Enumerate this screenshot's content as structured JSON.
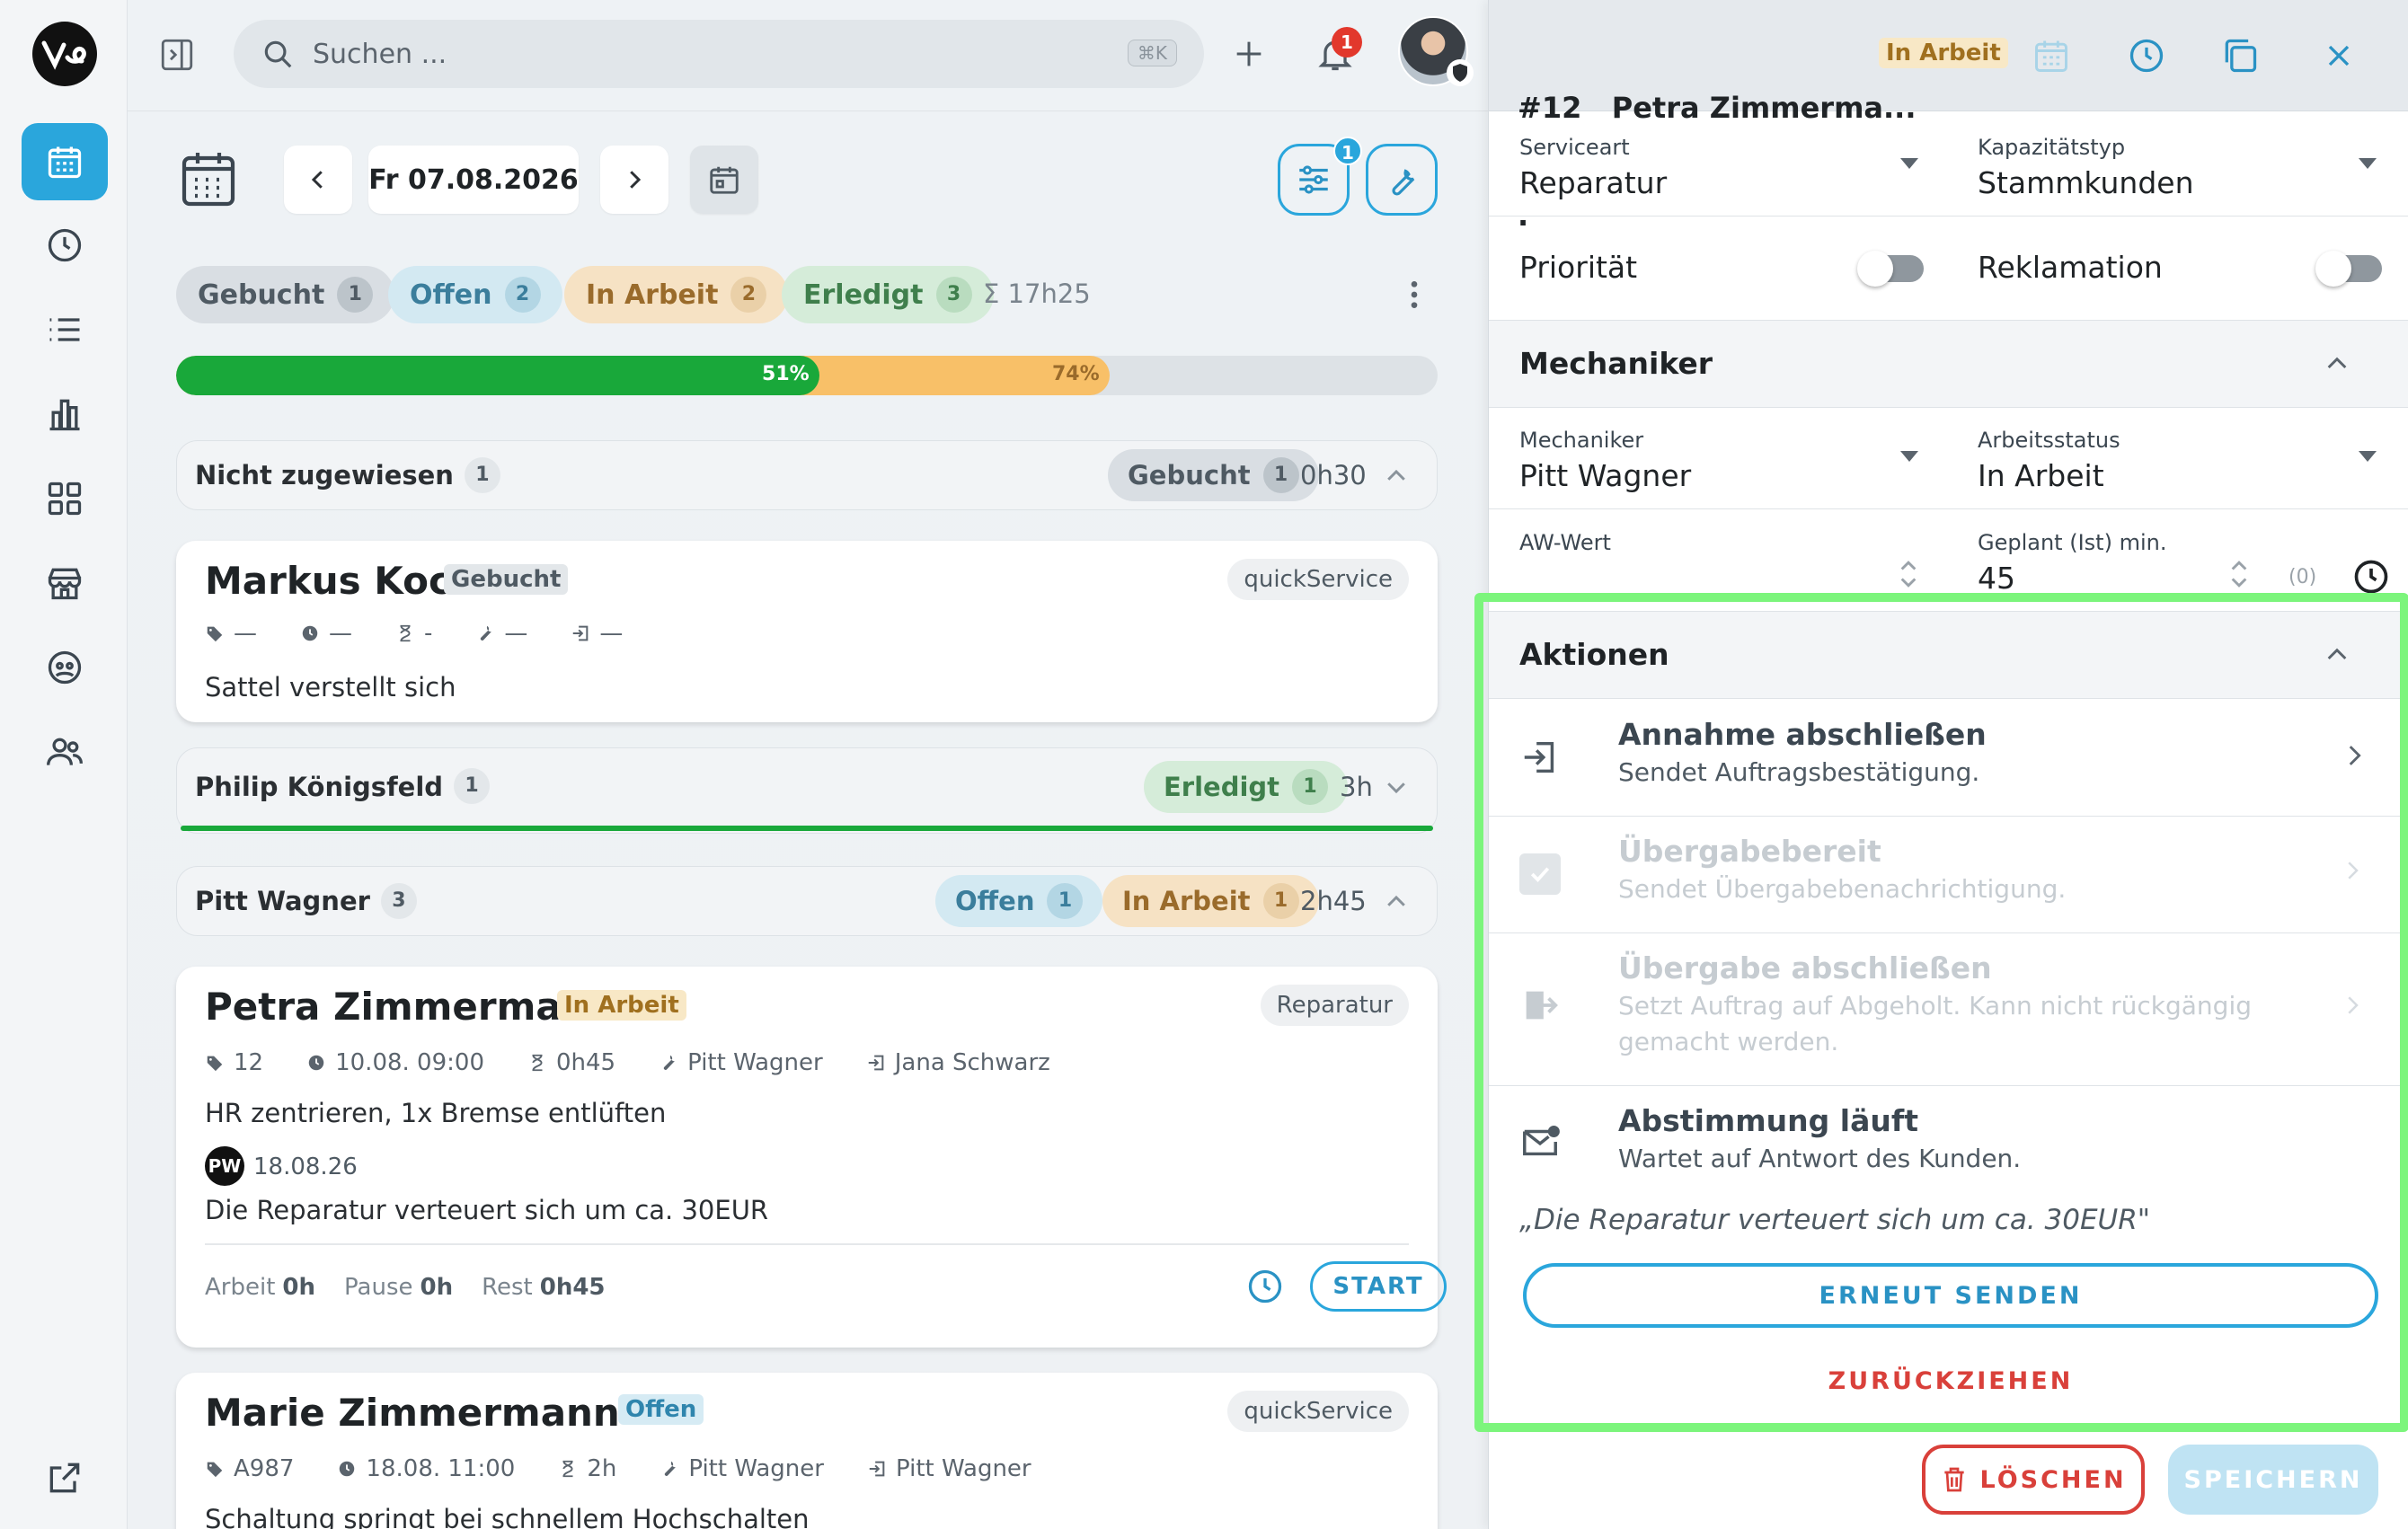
{
  "rail": {
    "logo_icon": "brand-logo",
    "items": [
      "calendar-icon",
      "clock-icon",
      "list-icon",
      "chart-icon",
      "grid-icon",
      "store-icon",
      "support-icon",
      "users-icon"
    ],
    "bottom": "external-link-icon"
  },
  "topbar": {
    "search_placeholder": "Suchen ...",
    "shortcut": "⌘K",
    "notification_count": "1"
  },
  "toolbar": {
    "date": "Fr 07.08.2026",
    "filter_count": "1"
  },
  "status": {
    "booked": {
      "label": "Gebucht",
      "count": "1"
    },
    "open": {
      "label": "Offen",
      "count": "2"
    },
    "in_work": {
      "label": "In Arbeit",
      "count": "2"
    },
    "done": {
      "label": "Erledigt",
      "count": "3"
    },
    "total": "Σ 17h25"
  },
  "progress": {
    "done_pct": 51,
    "work_pct": 74,
    "done_label": "51%",
    "work_label": "74%"
  },
  "groups": {
    "unassigned": {
      "name": "Nicht zugewiesen",
      "count": "1",
      "chip_label": "Gebucht",
      "chip_count": "1",
      "time": "0h30"
    },
    "philip": {
      "name": "Philip Königsfeld",
      "count": "1",
      "chip_label": "Erledigt",
      "chip_count": "1",
      "time": "3h"
    },
    "pitt": {
      "name": "Pitt Wagner",
      "count": "3",
      "chip1_label": "Offen",
      "chip1_count": "1",
      "chip2_label": "In Arbeit",
      "chip2_count": "1",
      "time": "2h45"
    }
  },
  "cards": {
    "markus": {
      "name": "Markus Koch",
      "status": "Gebucht",
      "type": "quickService",
      "m1": "—",
      "m2": "—",
      "m3": "-",
      "m4": "—",
      "m5": "—",
      "desc": "Sattel verstellt sich"
    },
    "petra": {
      "name": "Petra Zimmermann",
      "status": "In Arbeit",
      "type": "Reparatur",
      "m1": "12",
      "m2": "10.08. 09:00",
      "m3": "0h45",
      "m4": "Pitt Wagner",
      "m5": "Jana Schwarz",
      "desc": "HR zentrieren, 1x Bremse entlüften",
      "note_initials": "PW",
      "note_date": "18.08.26",
      "note_text": "Die Reparatur verteuert sich um ca. 30EUR",
      "work_label": "Arbeit",
      "work_val": "0h",
      "pause_label": "Pause",
      "pause_val": "0h",
      "rest_label": "Rest",
      "rest_val": "0h45",
      "start": "START"
    },
    "marie": {
      "name": "Marie Zimmermann",
      "status": "Offen",
      "type": "quickService",
      "m1": "A987",
      "m2": "18.08. 11:00",
      "m3": "2h",
      "m4": "Pitt Wagner",
      "m5": "Pitt Wagner",
      "desc": "Schaltung springt bei schnellem Hochschalten"
    }
  },
  "panel": {
    "title_line1": "#12   Petra Zimmerma...",
    "title_line2": ".",
    "status": "In Arbeit",
    "service_label": "Serviceart",
    "service_value": "Reparatur",
    "capacity_label": "Kapazitätstyp",
    "capacity_value": "Stammkunden",
    "priority_label": "Priorität",
    "complaint_label": "Reklamation",
    "mechanic_section": "Mechaniker",
    "mechanic_label": "Mechaniker",
    "mechanic_value": "Pitt Wagner",
    "workstatus_label": "Arbeitsstatus",
    "workstatus_value": "In Arbeit",
    "aw_label": "AW-Wert",
    "planned_label": "Geplant (Ist) min.",
    "planned_value": "45",
    "planned_actual": "(0)",
    "actions_section": "Aktionen",
    "actions": [
      {
        "title": "Annahme abschließen",
        "desc": "Sendet Auftragsbestätigung."
      },
      {
        "title": "Übergabebereit",
        "desc": "Sendet Übergabebenachrichtigung."
      },
      {
        "title": "Übergabe abschließen",
        "desc": "Setzt Auftrag auf Abgeholt. Kann nicht rückgängig gemacht werden."
      },
      {
        "title": "Abstimmung läuft",
        "desc": "Wartet auf Antwort des Kunden."
      }
    ],
    "quote": "„Die Reparatur verteuert sich um ca. 30EUR\"",
    "resend": "ERNEUT SENDEN",
    "withdraw": "ZURÜCKZIEHEN",
    "delete": "LÖSCHEN",
    "save": "SPEICHERN"
  },
  "colors": {
    "accent": "#2aa6dc",
    "green": "#19a83a",
    "orange": "#f8c068",
    "highlight": "#7cf57c",
    "danger": "#d9403a"
  }
}
